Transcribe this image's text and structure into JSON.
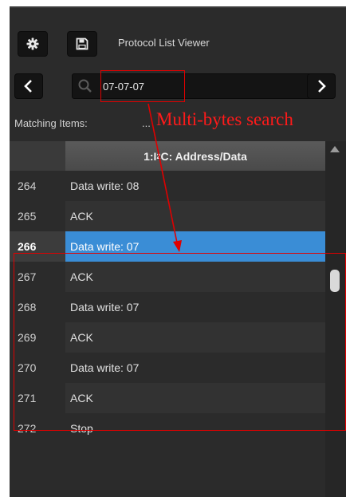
{
  "toolbar": {
    "title": "Protocol List Viewer",
    "settings_icon": "gear-icon",
    "save_icon": "floppy-disk-icon"
  },
  "search": {
    "value": "07-07-07",
    "prev_icon": "chevron-left-icon",
    "next_icon": "chevron-right-icon",
    "search_icon": "magnifier-icon"
  },
  "matching": {
    "label": "Matching Items:",
    "dots": "..."
  },
  "table": {
    "column_prefix": "1:I",
    "column_sup": "2",
    "column_suffix": "C: Address/Data",
    "rows": [
      {
        "num": "264",
        "text": "Data write: 08"
      },
      {
        "num": "265",
        "text": "ACK"
      },
      {
        "num": "266",
        "text": "Data write: 07"
      },
      {
        "num": "267",
        "text": "ACK"
      },
      {
        "num": "268",
        "text": "Data write: 07"
      },
      {
        "num": "269",
        "text": "ACK"
      },
      {
        "num": "270",
        "text": "Data write: 07"
      },
      {
        "num": "271",
        "text": "ACK"
      },
      {
        "num": "272",
        "text": "Stop"
      }
    ],
    "selected_row": "266"
  },
  "annotation": {
    "text": "Multi-bytes search",
    "color": "#e00000"
  },
  "colors": {
    "selection": "#3a8dd6",
    "panel": "#2b2b2b"
  }
}
